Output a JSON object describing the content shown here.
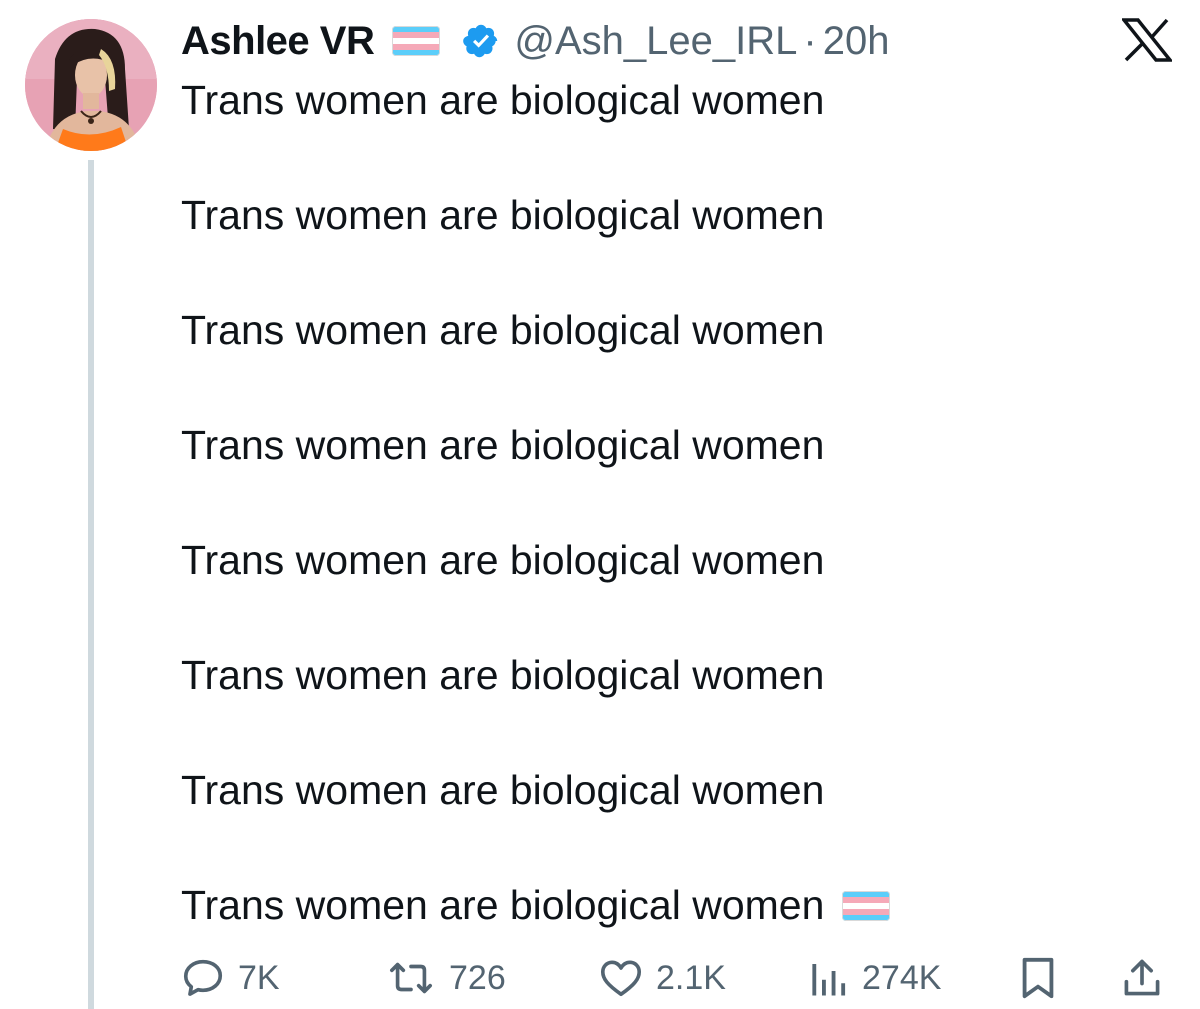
{
  "author": {
    "display_name": "Ashlee VR",
    "handle": "@Ash_Lee_IRL",
    "separator": "·",
    "time": "20h",
    "verified": true,
    "name_flag": "transgender-flag"
  },
  "platform_icon": "x-logo",
  "tweet": {
    "lines": [
      "Trans women are biological women",
      "Trans women are biological women",
      "Trans women are biological women",
      "Trans women are biological women",
      "Trans women are biological women",
      "Trans women are biological women",
      "Trans women are biological women",
      "Trans women are biological women"
    ],
    "trailing_emoji": "transgender-flag"
  },
  "actions": {
    "replies": "7K",
    "reposts": "726",
    "likes": "2.1K",
    "views": "274K"
  },
  "colors": {
    "text": "#0f1419",
    "secondary": "#536471",
    "verified": "#1d9bf0",
    "thread_line": "#cfd9de",
    "flag_blue": "#5bcefa",
    "flag_pink": "#f5a9b8",
    "flag_white": "#ffffff"
  }
}
